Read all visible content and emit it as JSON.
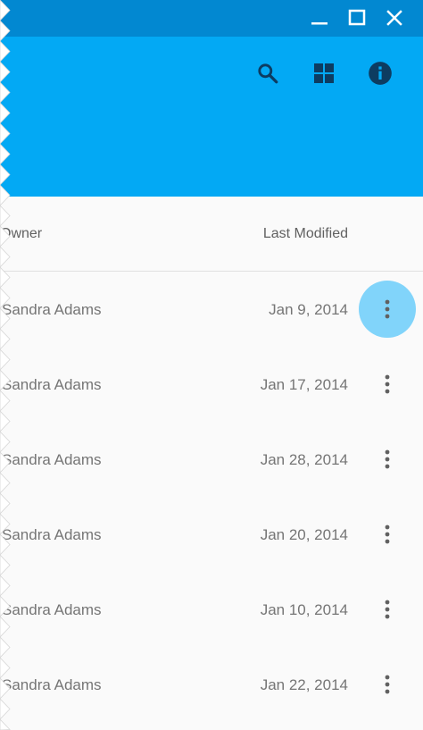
{
  "window": {
    "controls": [
      {
        "name": "minimize-icon",
        "role": "minimize"
      },
      {
        "name": "maximize-icon",
        "role": "maximize"
      },
      {
        "name": "close-icon",
        "role": "close"
      }
    ]
  },
  "appbar": {
    "actions": [
      {
        "name": "search-icon"
      },
      {
        "name": "grid-view-icon"
      },
      {
        "name": "info-icon"
      }
    ],
    "colors": {
      "titlebar": "#0288d1",
      "appbar": "#03a9f4"
    }
  },
  "table": {
    "headers": {
      "owner": "Owner",
      "last_modified": "Last Modified"
    },
    "rows": [
      {
        "owner": "Sandra Adams",
        "date": "Jan 9, 2014",
        "selected": true
      },
      {
        "owner": "Sandra Adams",
        "date": "Jan 17, 2014",
        "selected": false
      },
      {
        "owner": "Sandra Adams",
        "date": "Jan 28, 2014",
        "selected": false
      },
      {
        "owner": "Sandra Adams",
        "date": "Jan 20, 2014",
        "selected": false
      },
      {
        "owner": "Sandra Adams",
        "date": "Jan 10, 2014",
        "selected": false
      },
      {
        "owner": "Sandra Adams",
        "date": "Jan 22, 2014",
        "selected": false
      }
    ],
    "more_icon": "more-vert-icon",
    "highlight_color": "#81d4fa"
  }
}
